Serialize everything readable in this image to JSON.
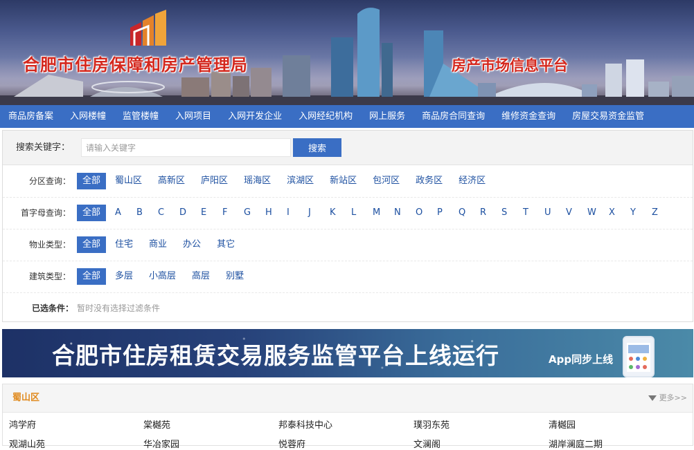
{
  "header": {
    "agency_title": "合肥市住房保障和房产管理局",
    "platform_title": "房产市场信息平台"
  },
  "nav": {
    "items": [
      "商品房备案",
      "入网楼幢",
      "监管楼幢",
      "入网项目",
      "入网开发企业",
      "入网经纪机构",
      "网上服务",
      "商品房合同查询",
      "维修资金查询",
      "房屋交易资金监管"
    ]
  },
  "search": {
    "label": "搜索关键字：",
    "placeholder": "请输入关键字",
    "value": "",
    "button": "搜索"
  },
  "filters": {
    "district": {
      "label": "分区查询：",
      "options": [
        "全部",
        "蜀山区",
        "高新区",
        "庐阳区",
        "瑶海区",
        "滨湖区",
        "新站区",
        "包河区",
        "政务区",
        "经济区"
      ],
      "selected": "全部"
    },
    "letter": {
      "label": "首字母查询：",
      "options": [
        "全部",
        "A",
        "B",
        "C",
        "D",
        "E",
        "F",
        "G",
        "H",
        "I",
        "J",
        "K",
        "L",
        "M",
        "N",
        "O",
        "P",
        "Q",
        "R",
        "S",
        "T",
        "U",
        "V",
        "W",
        "X",
        "Y",
        "Z"
      ],
      "selected": "全部"
    },
    "property_type": {
      "label": "物业类型：",
      "options": [
        "全部",
        "住宅",
        "商业",
        "办公",
        "其它"
      ],
      "selected": "全部"
    },
    "building_type": {
      "label": "建筑类型：",
      "options": [
        "全部",
        "多层",
        "小高层",
        "高层",
        "别墅"
      ],
      "selected": "全部"
    },
    "selected_conditions": {
      "label": "已选条件：",
      "value": "暂时没有选择过滤条件"
    }
  },
  "promo": {
    "title": "合肥市住房租赁交易服务监管平台上线运行",
    "app_note": "App同步上线"
  },
  "district_list": {
    "title": "蜀山区",
    "more": "更多>>",
    "row1": [
      "鸿学府",
      "棠樾苑",
      "邦泰科技中心",
      "璞羽东苑",
      "清樾园"
    ],
    "row2": [
      "观湖山苑",
      "华冶家园",
      "悦蓉府",
      "文澜阁",
      "湖岸澜庭二期"
    ]
  },
  "colors": {
    "nav_bg": "#3a6ec4",
    "title_red": "#d4281e",
    "link_blue": "#1c4fa0",
    "district_orange": "#e08a1e"
  }
}
